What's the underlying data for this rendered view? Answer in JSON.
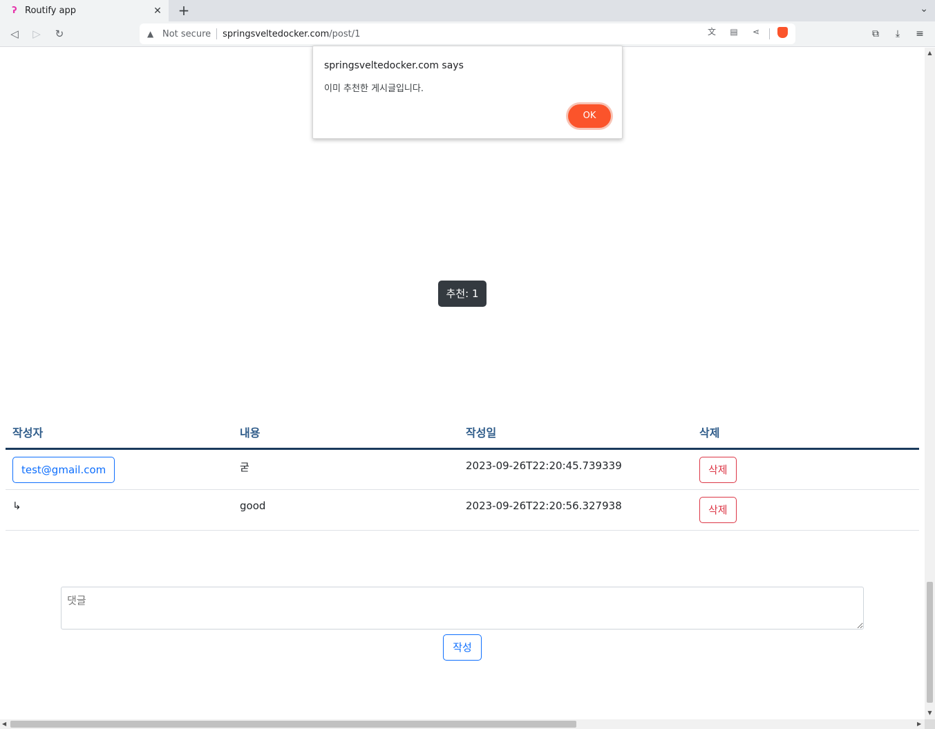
{
  "browser": {
    "tab_title": "Routify app",
    "tab_favicon": "routify-favicon",
    "security_label": "Not secure",
    "url_domain": "springsveltedocker.com",
    "url_path": "/post/1"
  },
  "dialog": {
    "origin": "springsveltedocker.com says",
    "message": "이미 추천한 게시글입니다.",
    "ok_label": "OK",
    "ok_color": "#fb542b"
  },
  "post": {
    "recommend_label": "추천: 1"
  },
  "comments_table": {
    "headers": [
      "작성자",
      "내용",
      "작성일",
      "삭제"
    ],
    "rows": [
      {
        "author": "test@gmail.com",
        "content": "굳",
        "date": "2023-09-26T22:20:45.739339",
        "delete_label": "삭제"
      },
      {
        "author": "↳",
        "content": "good",
        "date": "2023-09-26T22:20:56.327938",
        "delete_label": "삭제"
      }
    ]
  },
  "comment_form": {
    "placeholder": "댓글",
    "submit_label": "작성"
  },
  "colors": {
    "primary": "#0d6efd",
    "danger": "#dc3545",
    "header_text": "#2f5c8a",
    "dark_button": "#343a40"
  }
}
